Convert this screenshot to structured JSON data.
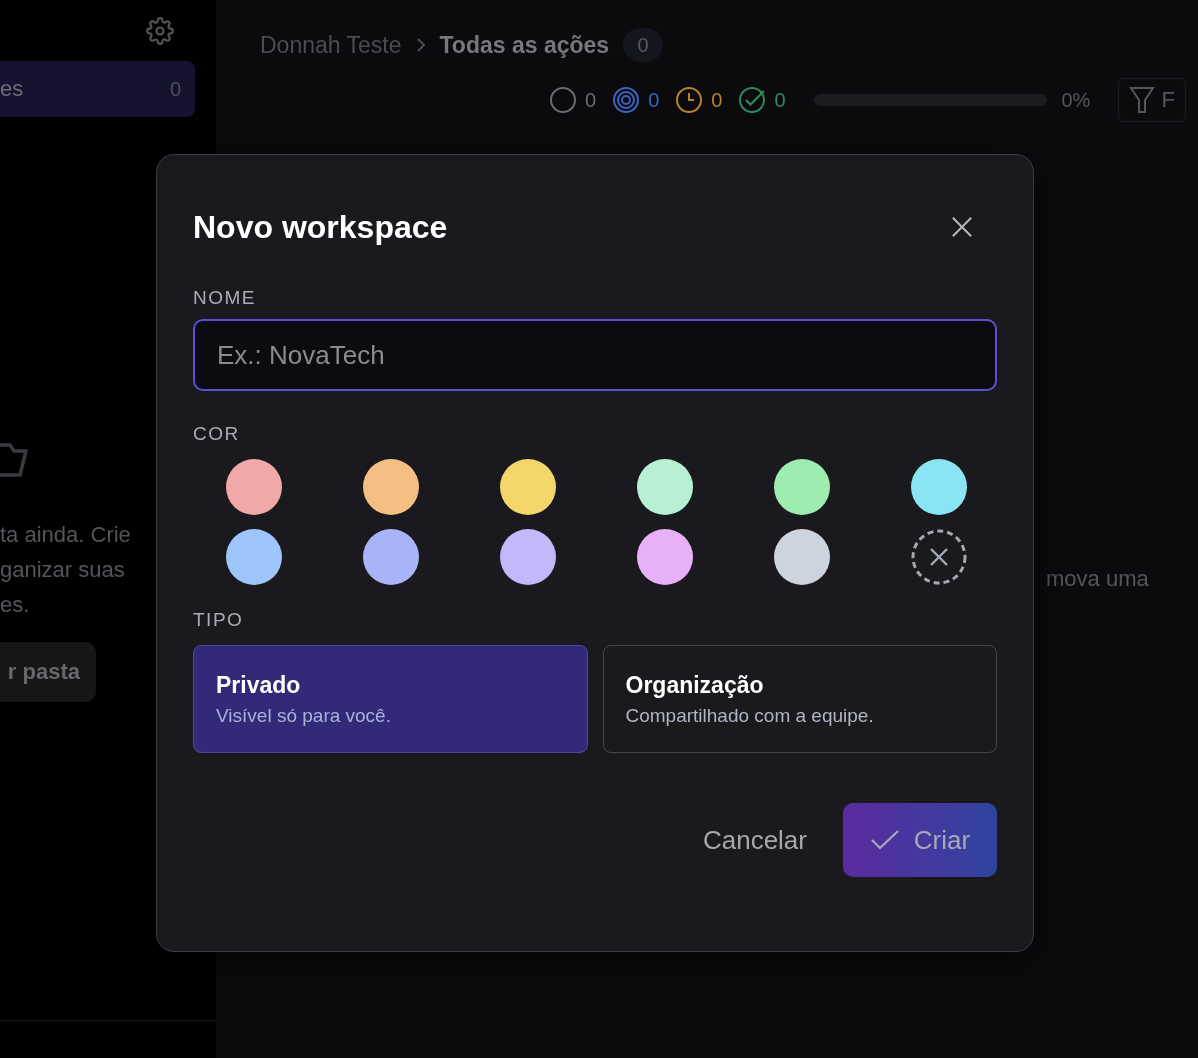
{
  "sidebar": {
    "active_item": {
      "label": "es",
      "count": "0",
      "selected": true
    },
    "empty_text": [
      "ta ainda. Crie",
      "ganizar suas",
      "es."
    ],
    "create_button": "r pasta"
  },
  "header": {
    "breadcrumb": [
      "Donnah Teste",
      "Todas as ações"
    ],
    "count": "0"
  },
  "stats": [
    {
      "kind": "open",
      "count": "0",
      "color": "#6b6b72"
    },
    {
      "kind": "target",
      "count": "0",
      "color": "#3b62c4"
    },
    {
      "kind": "clock",
      "count": "0",
      "color": "#b9832a"
    },
    {
      "kind": "done",
      "count": "0",
      "color": "#2f8a5c"
    }
  ],
  "progress": {
    "level": 0,
    "reading": "0%"
  },
  "filter_button": "F",
  "main_text": "mova uma",
  "dialog": {
    "title": "Novo workspace",
    "name_label": "NOME",
    "name_placeholder": "Ex.: NovaTech",
    "color_label": "COR",
    "colors": [
      {
        "kind": "swatch",
        "color": "#f0a8a8",
        "selected": false
      },
      {
        "kind": "swatch",
        "color": "#f3bf82",
        "selected": false
      },
      {
        "kind": "swatch",
        "color": "#f4d66a",
        "selected": false
      },
      {
        "kind": "swatch",
        "color": "#b8f0d4",
        "selected": false
      },
      {
        "kind": "swatch",
        "color": "#9eebb0",
        "selected": false
      },
      {
        "kind": "swatch",
        "color": "#8ae4f4",
        "selected": false
      },
      {
        "kind": "swatch",
        "color": "#9fc6fa",
        "selected": false
      },
      {
        "kind": "swatch",
        "color": "#a9b4f8",
        "selected": false
      },
      {
        "kind": "swatch",
        "color": "#c3b8fa",
        "selected": false
      },
      {
        "kind": "swatch",
        "color": "#e8b0f6",
        "selected": false
      },
      {
        "kind": "swatch",
        "color": "#cdd4de",
        "selected": false
      },
      {
        "kind": "none",
        "selected": false
      }
    ],
    "type_label": "TIPO",
    "types": [
      {
        "title": "Privado",
        "description": "Visível só para você.",
        "selected": true
      },
      {
        "title": "Organização",
        "description": "Compartilhado com a equipe.",
        "selected": false
      }
    ],
    "cancel": "Cancelar",
    "confirm": "Criar"
  }
}
